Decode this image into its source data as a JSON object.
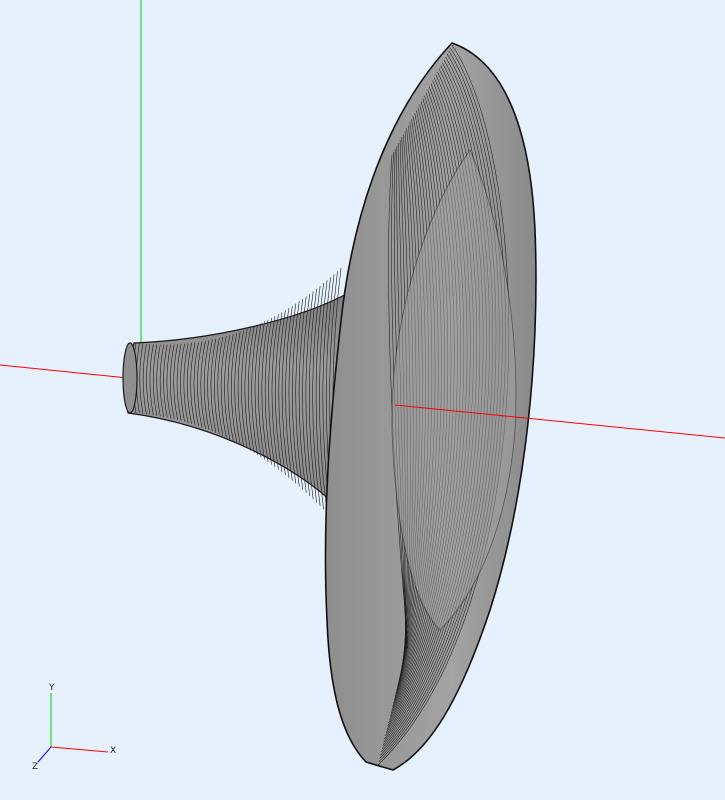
{
  "viewport": {
    "background": "#e6f1fd"
  },
  "model": {
    "name": "horn",
    "surface_color": "#9c9c9c",
    "edge_color": "#1a1a1a"
  },
  "scene_axes": {
    "x_color": "#ff0000",
    "y_color": "#00cc00"
  },
  "triad": {
    "x_label": "X",
    "y_label": "Y",
    "z_label": "Z",
    "x_color": "#ff0000",
    "y_color": "#00cc00",
    "z_color": "#0000ff"
  }
}
